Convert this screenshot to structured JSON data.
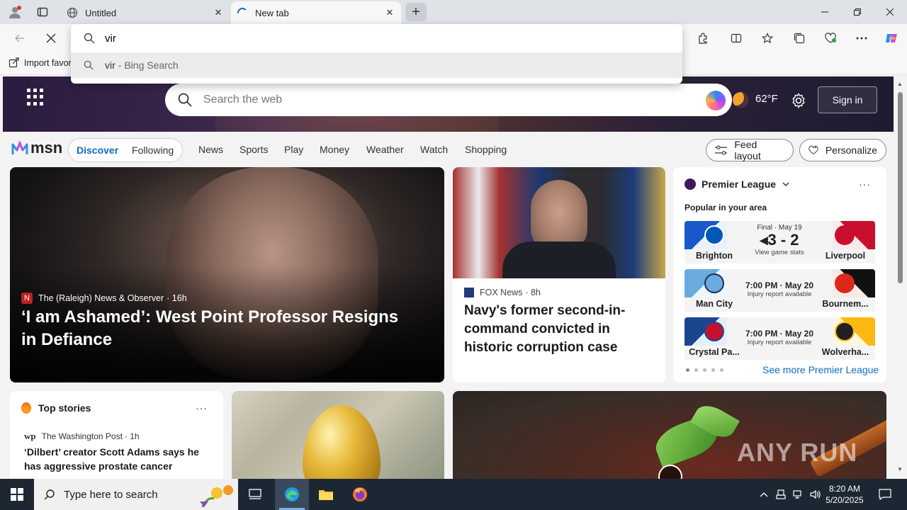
{
  "browser": {
    "tabs": [
      {
        "title": "Untitled"
      },
      {
        "title": "New tab"
      }
    ],
    "address": {
      "value": "vir"
    },
    "suggestion": {
      "query": "vir",
      "source": "- Bing Search"
    },
    "favorites_bar": {
      "import_label": "Import favor"
    }
  },
  "msn": {
    "search_placeholder": "Search the web",
    "temperature": "62°F",
    "sign_in": "Sign in",
    "logo_text": "msn",
    "pill_tabs": [
      "Discover",
      "Following"
    ],
    "nav": [
      "News",
      "Sports",
      "Play",
      "Money",
      "Weather",
      "Watch",
      "Shopping"
    ],
    "feed_layout": "Feed layout",
    "personalize": "Personalize",
    "hero": {
      "source": "The (Raleigh) News & Observer",
      "age": "· 16h",
      "headline": "‘I am Ashamed’: West Point Professor Resigns in Defiance"
    },
    "second": {
      "source": "FOX News",
      "age": "· 8h",
      "headline": "Navy's former second-in-command convicted in historic corruption case"
    },
    "premier_league": {
      "title": "Premier League",
      "subtitle": "Popular in your area",
      "matches": [
        {
          "home": "Brighton",
          "away": "Liverpool",
          "status": "Final · May 19",
          "score": "3 - 2",
          "note": "View game stats",
          "home_color": "#1858c9",
          "away_color": "#c8102e"
        },
        {
          "home": "Man City",
          "away": "Bournem...",
          "status": "7:00 PM · May 20",
          "note": "Injury report available",
          "home_color": "#6cabdd",
          "away_color": "#da291c"
        },
        {
          "home": "Crystal Pa...",
          "away": "Wolverha...",
          "status": "7:00 PM · May 20",
          "note": "Injury report available",
          "home_color": "#1b458f",
          "away_color": "#fdb913"
        }
      ],
      "see_more": "See more Premier League"
    },
    "top_stories": {
      "title": "Top stories",
      "source": "The Washington Post",
      "age": "· 1h",
      "headline": "‘Dilbert’ creator Scott Adams says he has aggressive prostate cancer"
    }
  },
  "taskbar": {
    "search_placeholder": "Type here to search",
    "time": "8:20 AM",
    "date": "5/20/2025"
  }
}
